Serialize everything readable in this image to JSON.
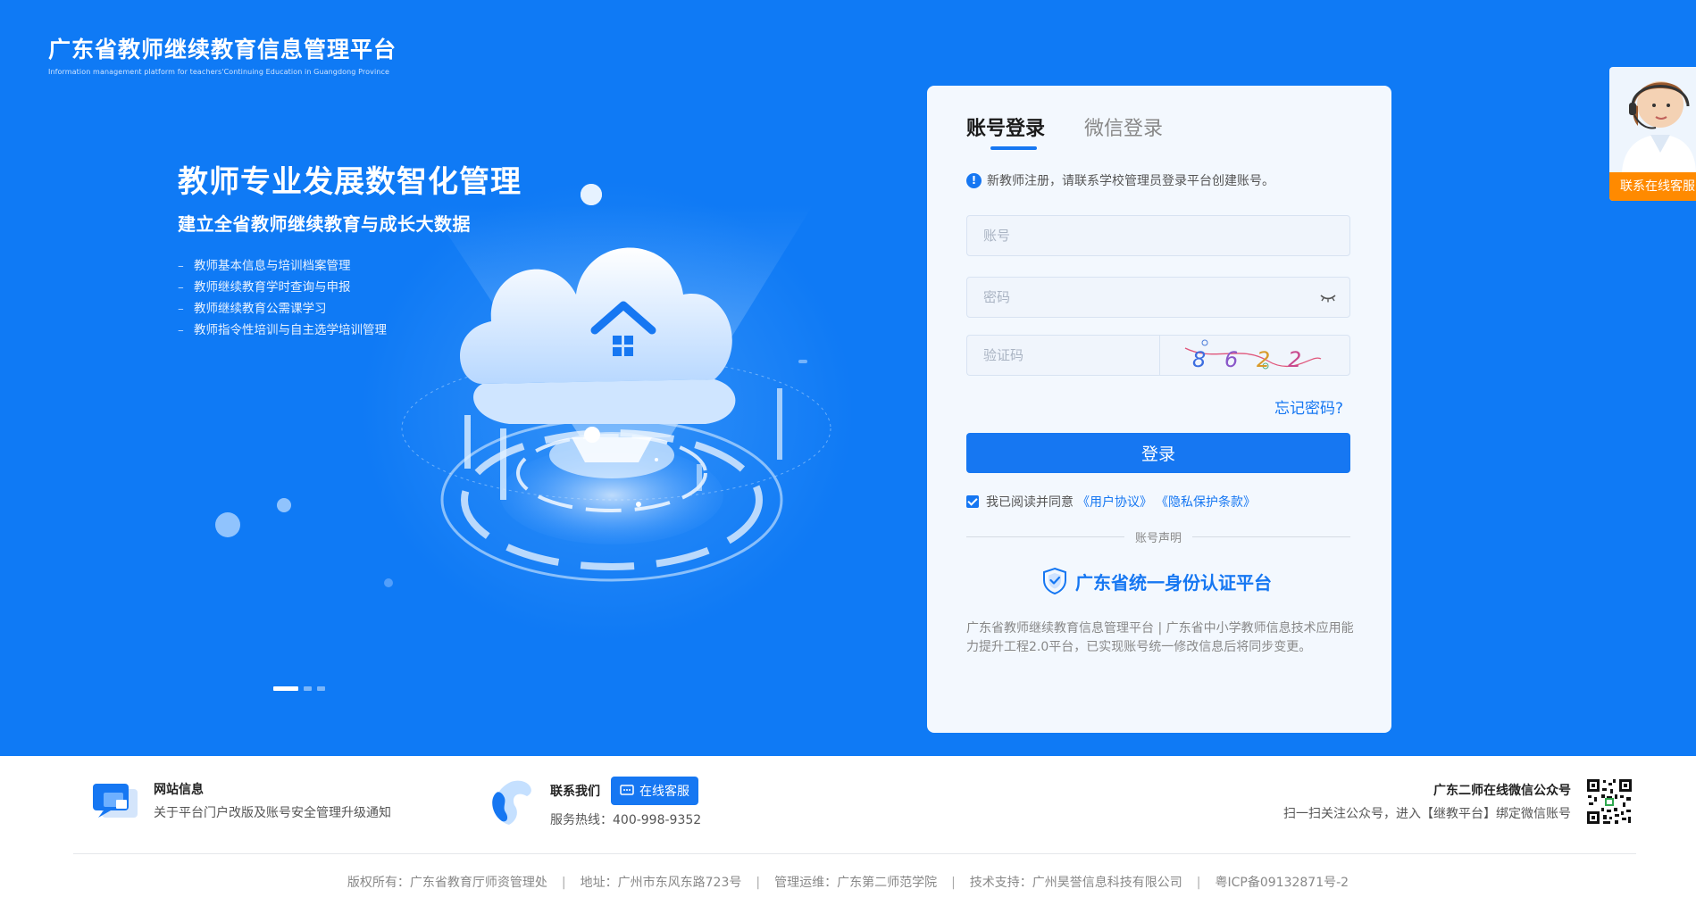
{
  "brand": {
    "title": "广东省教师继续教育信息管理平台",
    "subtitle": "Information management platform for teachers'Continuing Education in Guangdong Province"
  },
  "hero": {
    "slogan_main": "教师专业发展数智化管理",
    "slogan_sub": "建立全省教师继续教育与成长大数据",
    "features": [
      "教师基本信息与培训档案管理",
      "教师继续教育学时查询与申报",
      "教师继续教育公需课学习",
      "教师指令性培训与自主选学培训管理"
    ],
    "carousel": {
      "total": 3,
      "active": 1
    }
  },
  "login": {
    "tabs": [
      "账号登录",
      "微信登录"
    ],
    "active_tab": "账号登录",
    "notice": "新教师注册，请联系学校管理员登录平台创建账号。",
    "username_placeholder": "账号",
    "password_placeholder": "密码",
    "captcha_placeholder": "验证码",
    "captcha_text": "8622",
    "forgot": "忘记密码?",
    "submit": "登录",
    "agree_text": "我已阅读并同意",
    "agree_checked": true,
    "user_agreement": "《用户协议》",
    "privacy_policy": "《隐私保护条款》",
    "divider": "账号声明",
    "auth_platform": "广东省统一身份认证平台",
    "description": "广东省教师继续教育信息管理平台 | 广东省中小学教师信息技术应用能力提升工程2.0平台，已实现账号统一修改信息后将同步变更。"
  },
  "support": {
    "label": "联系在线客服"
  },
  "footer": {
    "site_title": "网站信息",
    "site_notice": "关于平台门户改版及账号安全管理升级通知",
    "contact_title": "联系我们",
    "service_button": "在线客服",
    "hotline": "服务热线：400-998-9352",
    "wechat_title": "广东二师在线微信公众号",
    "wechat_text": "扫一扫关注公众号，进入【继教平台】绑定微信账号",
    "copyright": [
      "版权所有：广东省教育厅师资管理处",
      "地址：广州市东风东路723号",
      "管理运维：广东第二师范学院",
      "技术支持：广州昊誉信息科技有限公司",
      "粤ICP备09132871号-2"
    ]
  },
  "colors": {
    "hero_bg": "#0f7af5",
    "accent": "#1677f2",
    "card_bg": "#f3f8fe",
    "support_label": "#ff8a00"
  }
}
